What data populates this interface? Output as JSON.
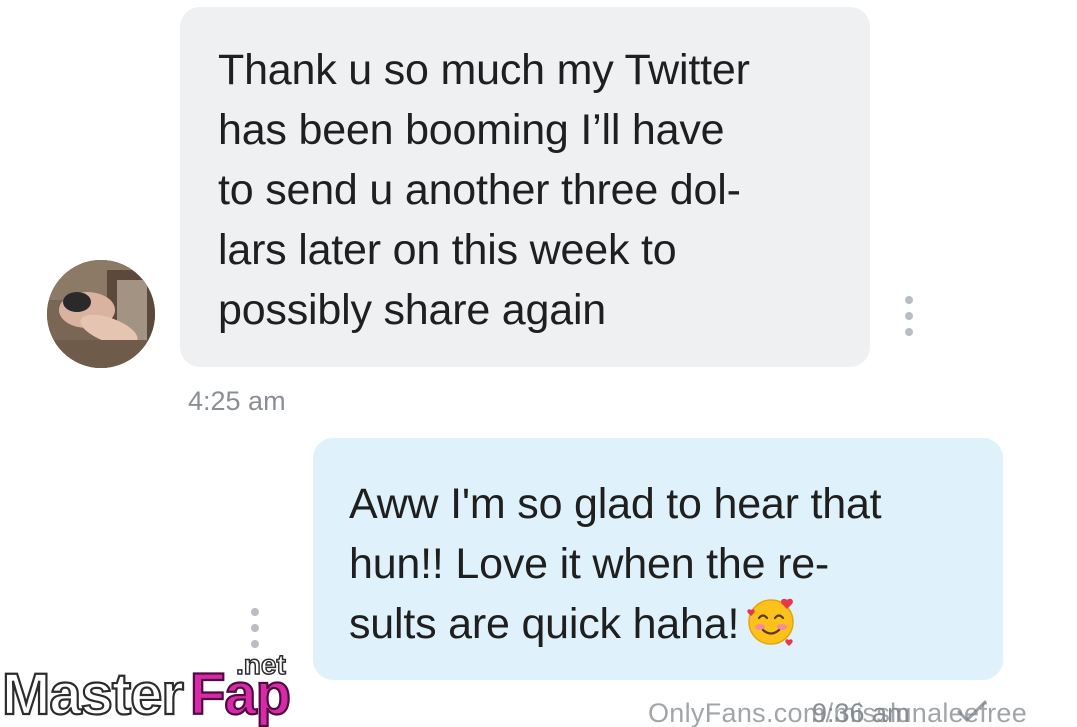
{
  "thread": {
    "messages": [
      {
        "direction": "incoming",
        "text": "Thank u so much my Twitter\nhas been booming I’ll have\nto send u another three dol-\nlars later on this week to\npossibly share again",
        "time": "4:25 am"
      },
      {
        "direction": "outgoing",
        "text": "Aww I'm so glad to hear that\nhun!! Love it when the re-\nsults are quick haha!",
        "emoji": "smiling-face-with-hearts",
        "time": "9:36 am"
      }
    ]
  },
  "overlays": {
    "onlyfans_watermark": "OnlyFans.com/misslunaleefree",
    "site_logo": "MasterFap.net"
  },
  "colors": {
    "incoming_bubble": "#eff0f2",
    "outgoing_bubble": "#dff2fb",
    "timestamp": "#8a8f95",
    "logo_accent": "#d72aa8"
  }
}
